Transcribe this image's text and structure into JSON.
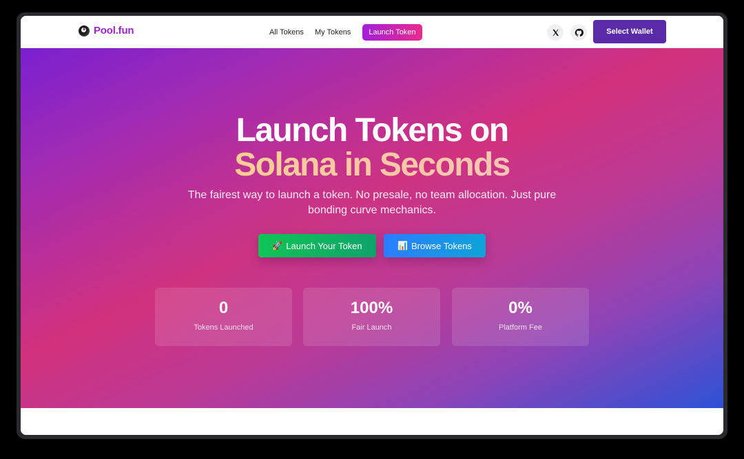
{
  "navbar": {
    "brand": {
      "icon": "8-ball-icon",
      "icon_glyph": "8",
      "name": "Pool.fun"
    },
    "links": [
      {
        "label": "All Tokens",
        "active": false
      },
      {
        "label": "My Tokens",
        "active": false
      },
      {
        "label": "Launch Token",
        "active": true
      }
    ],
    "icons": [
      "x-twitter-icon",
      "github-icon"
    ],
    "wallet_button": "Select Wallet"
  },
  "hero": {
    "title_line1": "Launch Tokens on",
    "title_line2": "Solana in Seconds",
    "subtitle": "The fairest way to launch a token. No presale, no team allocation. Just pure bonding curve mechanics.",
    "buttons": [
      {
        "emoji": "🚀",
        "label": "Launch Your Token",
        "color": "#10c456"
      },
      {
        "emoji": "📊",
        "label": "Browse Tokens",
        "color": "#2b7dff"
      }
    ],
    "stats": [
      {
        "value": "0",
        "label": "Tokens Launched"
      },
      {
        "value": "100%",
        "label": "Fair Launch"
      },
      {
        "value": "0%",
        "label": "Platform Fee"
      }
    ]
  },
  "colors": {
    "brand": "#9b27c7",
    "wallet": "#5a2aa8",
    "hero_start": "#7a1fd0",
    "hero_mid": "#d2317d",
    "hero_end": "#2c52d6"
  }
}
